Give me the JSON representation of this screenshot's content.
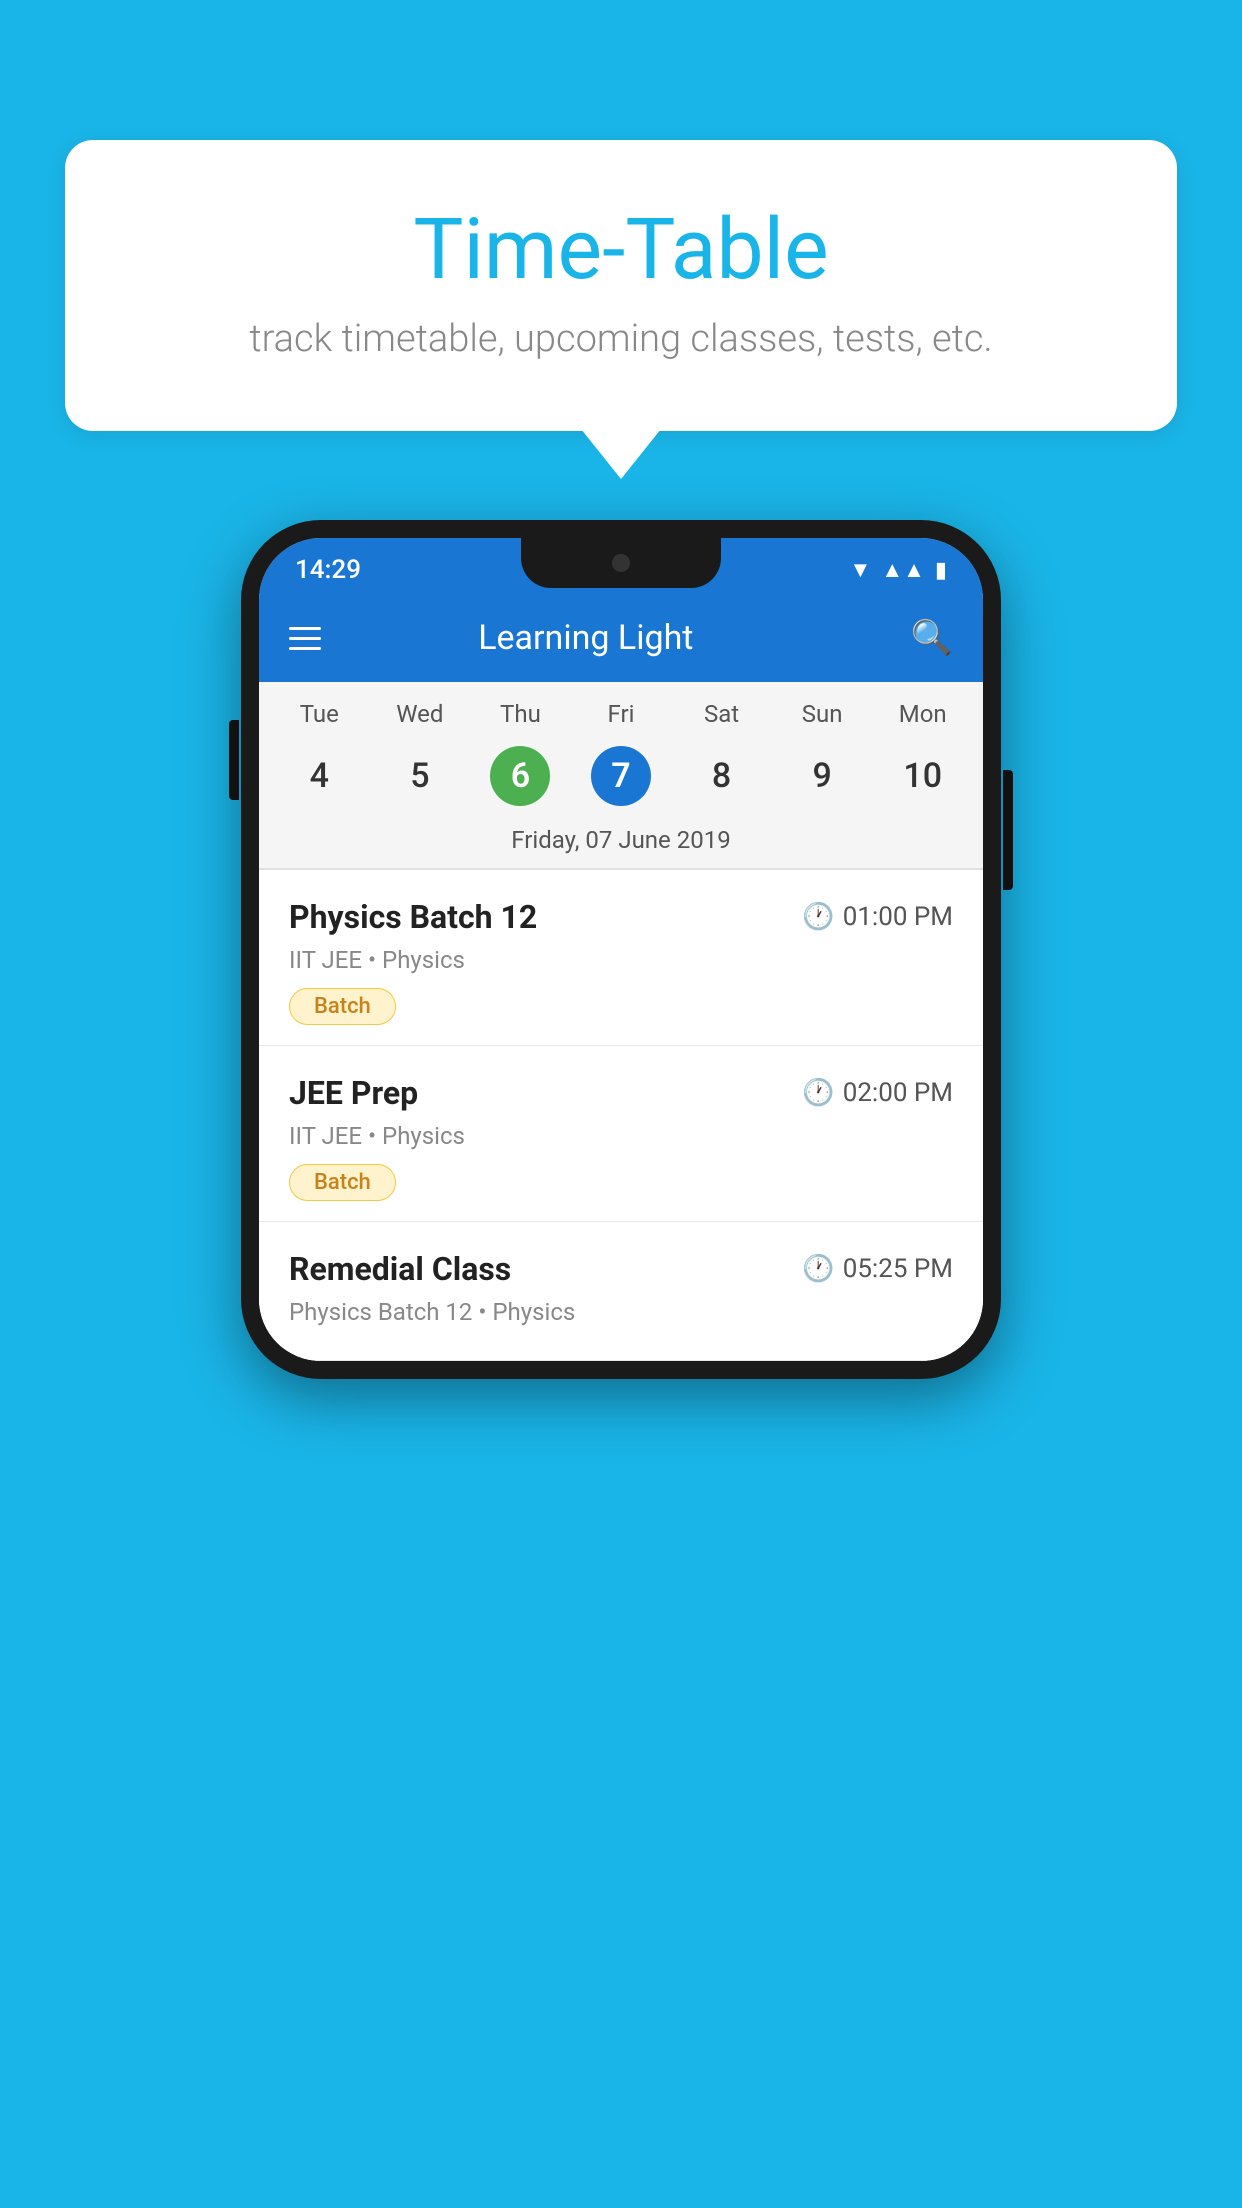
{
  "background_color": "#1ab5e8",
  "speech_bubble": {
    "title": "Time-Table",
    "subtitle": "track timetable, upcoming classes, tests, etc."
  },
  "phone": {
    "status_bar": {
      "time": "14:29",
      "wifi": "▼",
      "signal": "▲",
      "battery": "▌"
    },
    "app_bar": {
      "title": "Learning Light"
    },
    "calendar": {
      "days": [
        {
          "label": "Tue",
          "num": "4"
        },
        {
          "label": "Wed",
          "num": "5"
        },
        {
          "label": "Thu",
          "num": "6",
          "style": "green"
        },
        {
          "label": "Fri",
          "num": "7",
          "style": "blue"
        },
        {
          "label": "Sat",
          "num": "8"
        },
        {
          "label": "Sun",
          "num": "9"
        },
        {
          "label": "Mon",
          "num": "10"
        }
      ],
      "selected_date": "Friday, 07 June 2019"
    },
    "classes": [
      {
        "name": "Physics Batch 12",
        "time": "01:00 PM",
        "meta": "IIT JEE • Physics",
        "badge": "Batch"
      },
      {
        "name": "JEE Prep",
        "time": "02:00 PM",
        "meta": "IIT JEE • Physics",
        "badge": "Batch"
      },
      {
        "name": "Remedial Class",
        "time": "05:25 PM",
        "meta": "Physics Batch 12 • Physics",
        "badge": ""
      }
    ]
  }
}
